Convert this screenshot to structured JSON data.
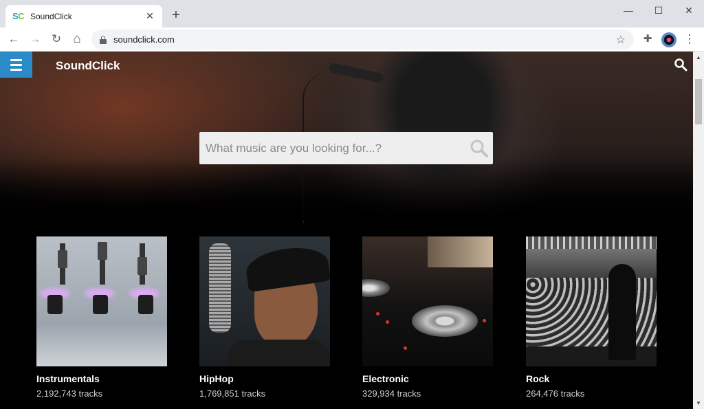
{
  "browser": {
    "tab": {
      "favicon_text": "SC",
      "title": "SoundClick",
      "close_glyph": "✕"
    },
    "new_tab_glyph": "+",
    "window_controls": {
      "minimize": "—",
      "maximize": "☐",
      "close": "✕"
    },
    "nav": {
      "back": "←",
      "forward": "→",
      "reload": "↻",
      "home": "⌂"
    },
    "url": "soundclick.com",
    "bookmark_glyph": "☆",
    "extensions_glyph": "✚",
    "menu_glyph": "⋮"
  },
  "site": {
    "logo": "SoundClick",
    "search": {
      "placeholder": "What music are you looking for...?"
    },
    "genres": [
      {
        "name": "Instrumentals",
        "count": "2,192,743 tracks"
      },
      {
        "name": "HipHop",
        "count": "1,769,851 tracks"
      },
      {
        "name": "Electronic",
        "count": "329,934 tracks"
      },
      {
        "name": "Rock",
        "count": "264,476 tracks"
      }
    ]
  },
  "scrollbar": {
    "up_glyph": "▲",
    "down_glyph": "▼"
  },
  "colors": {
    "menu_button": "#2b8bc8",
    "search_box": "#eeeeee",
    "page_background": "#000000"
  }
}
